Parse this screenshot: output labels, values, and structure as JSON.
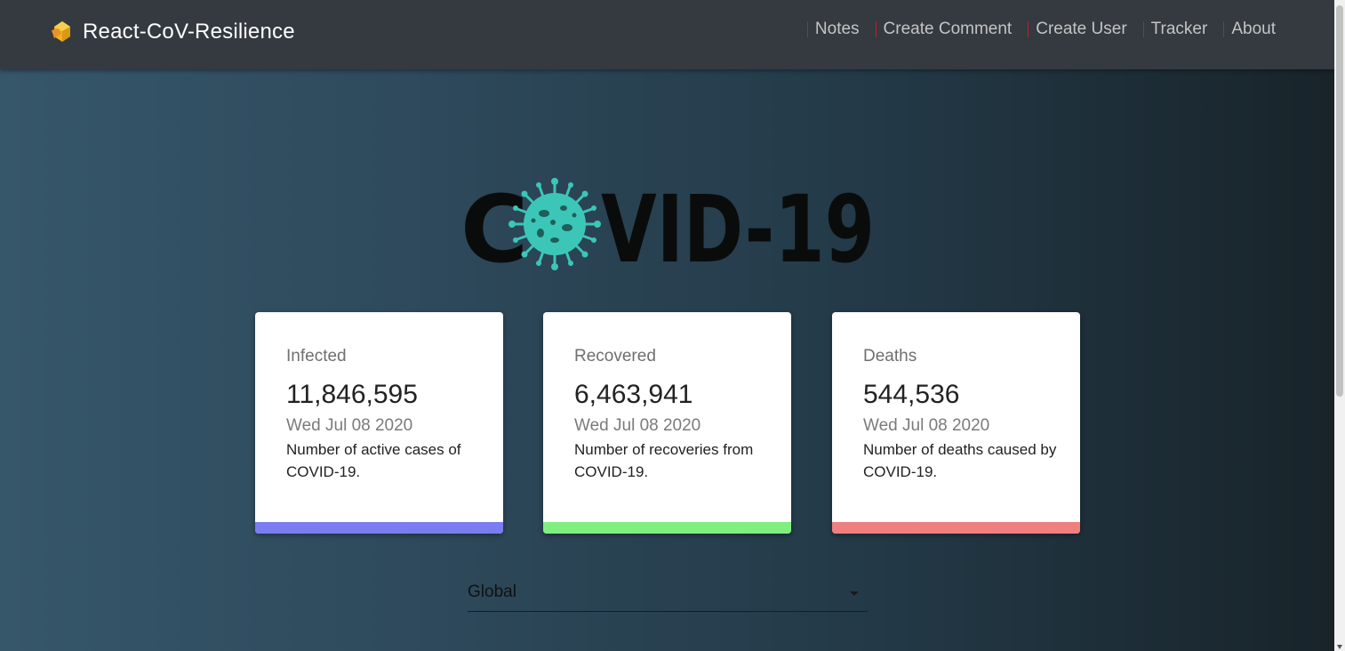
{
  "navbar": {
    "brand": "React-CoV-Resilience",
    "links": [
      {
        "label": "Notes"
      },
      {
        "label": "Create Comment"
      },
      {
        "label": "Create User"
      },
      {
        "label": "Tracker"
      },
      {
        "label": "About"
      }
    ],
    "separator_color": "#b0252c"
  },
  "hero": {
    "logo_text_left": "C",
    "logo_text_right": "VID-19",
    "logo_icon": "virus-icon",
    "virus_color": "#3cc6b8"
  },
  "cards": [
    {
      "title": "Infected",
      "value": "11,846,595",
      "date": "Wed Jul 08 2020",
      "description": "Number of active cases of COVID-19.",
      "accent_color": "#7b7cf0"
    },
    {
      "title": "Recovered",
      "value": "6,463,941",
      "date": "Wed Jul 08 2020",
      "description": "Number of recoveries from COVID-19.",
      "accent_color": "#7ff07f"
    },
    {
      "title": "Deaths",
      "value": "544,536",
      "date": "Wed Jul 08 2020",
      "description": "Number of deaths caused by COVID-19.",
      "accent_color": "#f07f7f"
    }
  ],
  "country_picker": {
    "selected": "Global"
  }
}
